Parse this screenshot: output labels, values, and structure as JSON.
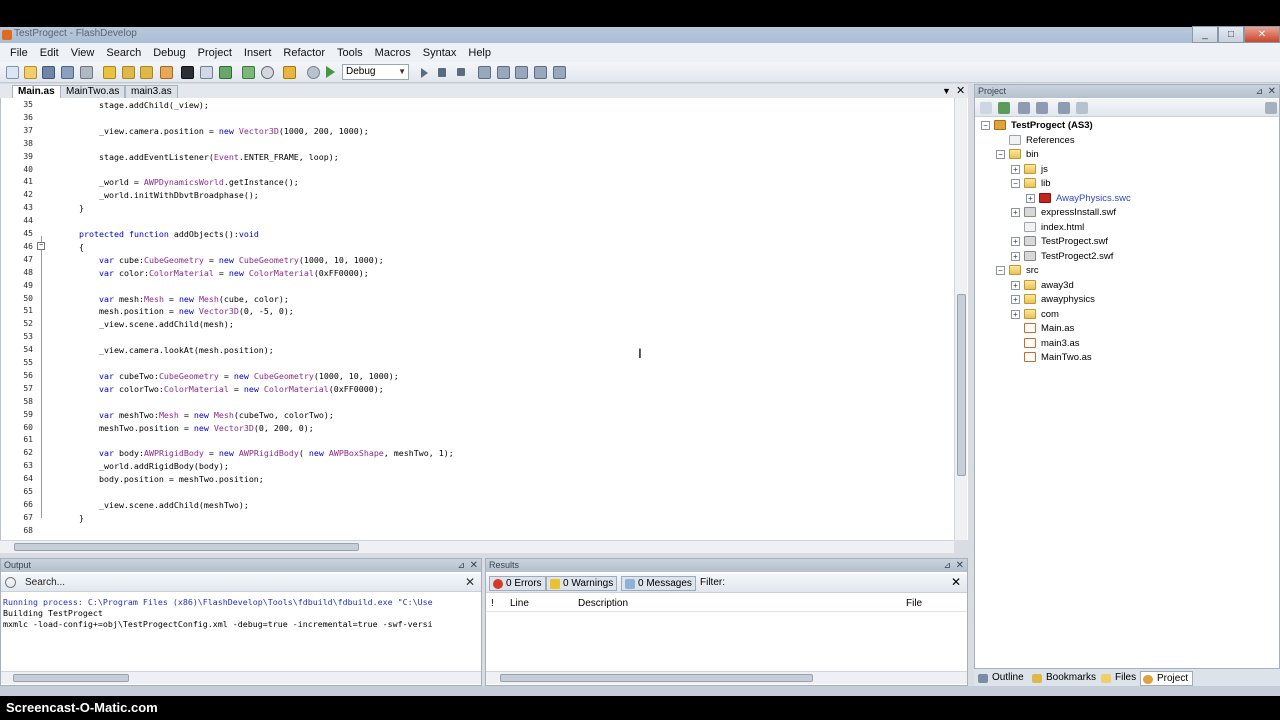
{
  "window": {
    "title": "TestProgect - FlashDevelop",
    "min": "_",
    "max": "□",
    "close": "✕"
  },
  "menu": [
    "File",
    "Edit",
    "View",
    "Search",
    "Debug",
    "Project",
    "Insert",
    "Refactor",
    "Tools",
    "Macros",
    "Syntax",
    "Help"
  ],
  "toolbar": {
    "config_value": "Debug"
  },
  "tabs": [
    {
      "label": "Main.as",
      "active": true
    },
    {
      "label": "MainTwo.as",
      "active": false
    },
    {
      "label": "main3.as",
      "active": false
    }
  ],
  "editor": {
    "lines": [
      {
        "n": "35",
        "text": "        stage.addChild(_view);"
      },
      {
        "n": "36",
        "text": ""
      },
      {
        "n": "37",
        "text": "        _view.camera.position = new Vector3D(1000, 200, 1000);"
      },
      {
        "n": "38",
        "text": ""
      },
      {
        "n": "39",
        "text": "        stage.addEventListener(Event.ENTER_FRAME, loop);"
      },
      {
        "n": "40",
        "text": ""
      },
      {
        "n": "41",
        "text": "        _world = AWPDynamicsWorld.getInstance();"
      },
      {
        "n": "42",
        "text": "        _world.initWithDbvtBroadphase();"
      },
      {
        "n": "43",
        "text": "    }"
      },
      {
        "n": "44",
        "text": ""
      },
      {
        "n": "45",
        "text": "    protected function addObjects():void"
      },
      {
        "n": "46",
        "text": "    {"
      },
      {
        "n": "47",
        "text": "        var cube:CubeGeometry = new CubeGeometry(1000, 10, 1000);"
      },
      {
        "n": "48",
        "text": "        var color:ColorMaterial = new ColorMaterial(0xFF0000);"
      },
      {
        "n": "49",
        "text": ""
      },
      {
        "n": "50",
        "text": "        var mesh:Mesh = new Mesh(cube, color);"
      },
      {
        "n": "51",
        "text": "        mesh.position = new Vector3D(0, -5, 0);"
      },
      {
        "n": "52",
        "text": "        _view.scene.addChild(mesh);"
      },
      {
        "n": "53",
        "text": ""
      },
      {
        "n": "54",
        "text": "        _view.camera.lookAt(mesh.position);"
      },
      {
        "n": "55",
        "text": ""
      },
      {
        "n": "56",
        "text": "        var cubeTwo:CubeGeometry = new CubeGeometry(1000, 10, 1000);"
      },
      {
        "n": "57",
        "text": "        var colorTwo:ColorMaterial = new ColorMaterial(0xFF0000);"
      },
      {
        "n": "58",
        "text": ""
      },
      {
        "n": "59",
        "text": "        var meshTwo:Mesh = new Mesh(cubeTwo, colorTwo);"
      },
      {
        "n": "60",
        "text": "        meshTwo.position = new Vector3D(0, 200, 0);"
      },
      {
        "n": "61",
        "text": ""
      },
      {
        "n": "62",
        "text": "        var body:AWPRigidBody = new AWPRigidBody( new AWPBoxShape, meshTwo, 1);"
      },
      {
        "n": "63",
        "text": "        _world.addRigidBody(body);"
      },
      {
        "n": "64",
        "text": "        body.position = meshTwo.position;"
      },
      {
        "n": "65",
        "text": ""
      },
      {
        "n": "66",
        "text": "        _view.scene.addChild(meshTwo);"
      },
      {
        "n": "67",
        "text": "    }"
      },
      {
        "n": "68",
        "text": ""
      }
    ]
  },
  "output": {
    "title": "Output",
    "search_placeholder": "Search...",
    "lines": [
      "Running process: C:\\Program Files (x86)\\FlashDevelop\\Tools\\fdbuild\\fdbuild.exe \"C:\\Use",
      "Building TestProgect",
      "mxmlc -load-config+=obj\\TestProgectConfig.xml -debug=true -incremental=true -swf-versi"
    ]
  },
  "results": {
    "title": "Results",
    "errors": "0 Errors",
    "warnings": "0 Warnings",
    "messages": "0 Messages",
    "filter": "Filter:",
    "columns": [
      "!",
      "Line",
      "Description",
      "File"
    ]
  },
  "project": {
    "title": "Project",
    "tree": [
      {
        "label": "TestProgect (AS3)",
        "depth": 0,
        "icon": "proj",
        "exp": "-",
        "bold": true
      },
      {
        "label": "References",
        "depth": 1,
        "icon": "file",
        "exp": ""
      },
      {
        "label": "bin",
        "depth": 1,
        "icon": "folder",
        "exp": "-"
      },
      {
        "label": "js",
        "depth": 2,
        "icon": "folder",
        "exp": "+"
      },
      {
        "label": "lib",
        "depth": 2,
        "icon": "folder",
        "exp": "-"
      },
      {
        "label": "AwayPhysics.swc",
        "depth": 3,
        "icon": "swcred",
        "exp": "+",
        "color": "#3046c8"
      },
      {
        "label": "expressInstall.swf",
        "depth": 2,
        "icon": "swf",
        "exp": "+"
      },
      {
        "label": "index.html",
        "depth": 2,
        "icon": "file",
        "exp": ""
      },
      {
        "label": "TestProgect.swf",
        "depth": 2,
        "icon": "swf",
        "exp": "+"
      },
      {
        "label": "TestProgect2.swf",
        "depth": 2,
        "icon": "swf",
        "exp": "+"
      },
      {
        "label": "src",
        "depth": 1,
        "icon": "folder",
        "exp": "-"
      },
      {
        "label": "away3d",
        "depth": 2,
        "icon": "folder",
        "exp": "+"
      },
      {
        "label": "awayphysics",
        "depth": 2,
        "icon": "folder",
        "exp": "+"
      },
      {
        "label": "com",
        "depth": 2,
        "icon": "folder",
        "exp": "+"
      },
      {
        "label": "Main.as",
        "depth": 2,
        "icon": "asf",
        "exp": ""
      },
      {
        "label": "main3.as",
        "depth": 2,
        "icon": "asf",
        "exp": ""
      },
      {
        "label": "MainTwo.as",
        "depth": 2,
        "icon": "asf",
        "exp": ""
      }
    ],
    "bottom_tabs": [
      {
        "label": "Outline",
        "active": false
      },
      {
        "label": "Bookmarks",
        "active": false
      },
      {
        "label": "Files",
        "active": false
      },
      {
        "label": "Project",
        "active": true
      }
    ]
  },
  "watermark": "Screencast-O-Matic.com"
}
